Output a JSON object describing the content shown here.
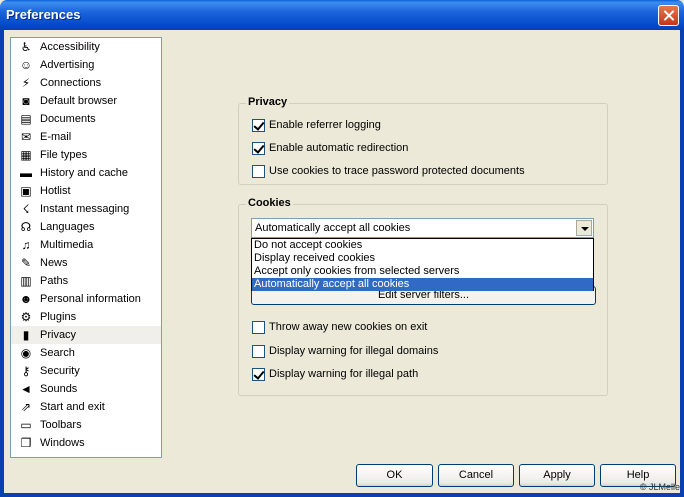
{
  "window": {
    "title": "Preferences"
  },
  "sidebar": {
    "items": [
      {
        "label": "Accessibility",
        "icon": "accessibility-icon",
        "glyph": "♿"
      },
      {
        "label": "Advertising",
        "icon": "smiley-icon",
        "glyph": "☺"
      },
      {
        "label": "Connections",
        "icon": "plug-icon",
        "glyph": "⚡"
      },
      {
        "label": "Default browser",
        "icon": "default-browser-icon",
        "glyph": "◙"
      },
      {
        "label": "Documents",
        "icon": "document-icon",
        "glyph": "▤"
      },
      {
        "label": "E-mail",
        "icon": "envelope-icon",
        "glyph": "✉"
      },
      {
        "label": "File types",
        "icon": "file-types-icon",
        "glyph": "▦"
      },
      {
        "label": "History and cache",
        "icon": "history-icon",
        "glyph": "▬"
      },
      {
        "label": "Hotlist",
        "icon": "hotlist-icon",
        "glyph": "▣"
      },
      {
        "label": "Instant messaging",
        "icon": "messaging-icon",
        "glyph": "☇"
      },
      {
        "label": "Languages",
        "icon": "languages-icon",
        "glyph": "☊"
      },
      {
        "label": "Multimedia",
        "icon": "multimedia-icon",
        "glyph": "♫"
      },
      {
        "label": "News",
        "icon": "news-icon",
        "glyph": "✎"
      },
      {
        "label": "Paths",
        "icon": "paths-icon",
        "glyph": "▥"
      },
      {
        "label": "Personal information",
        "icon": "person-icon",
        "glyph": "☻"
      },
      {
        "label": "Plugins",
        "icon": "plugins-icon",
        "glyph": "⚙"
      },
      {
        "label": "Privacy",
        "icon": "privacy-icon",
        "glyph": "▮"
      },
      {
        "label": "Search",
        "icon": "search-icon",
        "glyph": "◉"
      },
      {
        "label": "Security",
        "icon": "key-icon",
        "glyph": "⚷"
      },
      {
        "label": "Sounds",
        "icon": "speaker-icon",
        "glyph": "◄"
      },
      {
        "label": "Start and exit",
        "icon": "start-exit-icon",
        "glyph": "⇗"
      },
      {
        "label": "Toolbars",
        "icon": "toolbars-icon",
        "glyph": "▭"
      },
      {
        "label": "Windows",
        "icon": "windows-icon",
        "glyph": "❐"
      }
    ],
    "selected": "Privacy"
  },
  "privacy": {
    "title": "Privacy",
    "options": [
      {
        "label": "Enable referrer logging",
        "checked": true
      },
      {
        "label": "Enable automatic redirection",
        "checked": true
      },
      {
        "label": "Use cookies to trace password protected documents",
        "checked": false
      }
    ]
  },
  "cookies": {
    "title": "Cookies",
    "selected": "Automatically accept all cookies",
    "dropdown_options": [
      "Do not accept cookies",
      "Display received cookies",
      "Accept only cookies from selected servers",
      "Automatically accept all cookies"
    ],
    "server_filters_label": "Edit server filters...",
    "options": [
      {
        "label": "Throw away new cookies on exit",
        "checked": false
      },
      {
        "label": "Display warning for illegal domains",
        "checked": false
      },
      {
        "label": "Display warning for illegal path",
        "checked": true
      }
    ]
  },
  "buttons": {
    "ok": "OK",
    "cancel": "Cancel",
    "apply": "Apply",
    "help": "Help"
  },
  "copyright": "© JLMelle"
}
